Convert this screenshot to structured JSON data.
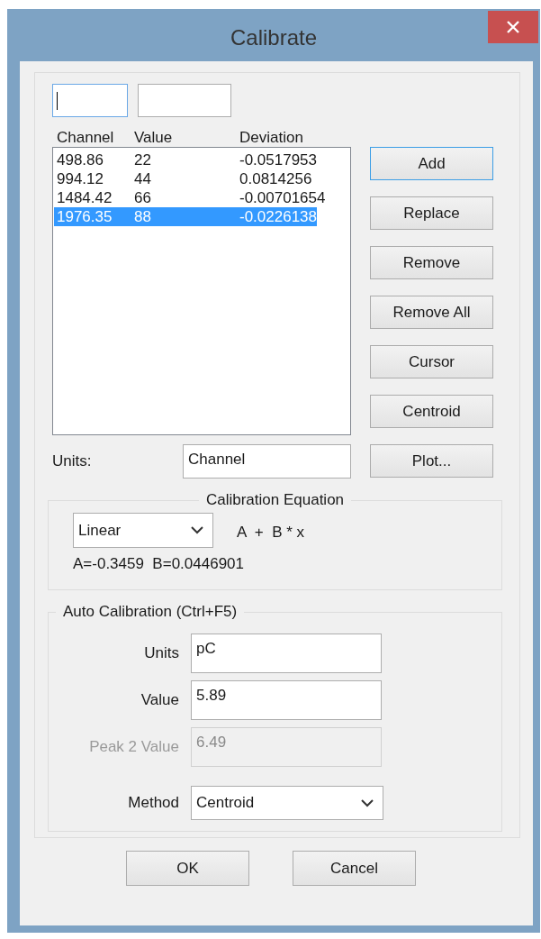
{
  "window": {
    "title": "Calibrate"
  },
  "entry_fields": [
    {
      "focused": true
    },
    {
      "focused": false
    }
  ],
  "list": {
    "columns": [
      "Channel",
      "Value",
      "Deviation"
    ],
    "rows": [
      {
        "cells": [
          "498.86",
          "22",
          "-0.0517953"
        ],
        "selected": false
      },
      {
        "cells": [
          "994.12",
          "44",
          "0.0814256"
        ],
        "selected": false
      },
      {
        "cells": [
          "1484.42",
          "66",
          "-0.00701654"
        ],
        "selected": false
      },
      {
        "cells": [
          "1976.35",
          "88",
          "-0.0226138"
        ],
        "selected": true
      }
    ]
  },
  "buttons": [
    {
      "label": "Add",
      "default": true
    },
    {
      "label": "Replace",
      "default": false
    },
    {
      "label": "Remove",
      "default": false
    },
    {
      "label": "Remove All",
      "default": false
    },
    {
      "label": "Cursor",
      "default": false
    },
    {
      "label": "Centroid",
      "default": false
    },
    {
      "label": "Plot...",
      "default": false
    }
  ],
  "units": {
    "label": "Units:",
    "value": "Channel"
  },
  "equation": {
    "title": "Calibration Equation",
    "type": "Linear",
    "formula": "A  +  B * x",
    "coefficients": "A=-0.3459  B=0.0446901"
  },
  "auto": {
    "title": "Auto Calibration (Ctrl+F5)",
    "fields": [
      {
        "kind": "text",
        "label": "Units",
        "value": "pC",
        "disabled": false
      },
      {
        "kind": "text",
        "label": "Value",
        "value": "5.89",
        "disabled": false
      },
      {
        "kind": "text",
        "label": "Peak 2 Value",
        "value": "6.49",
        "disabled": true
      },
      {
        "kind": "select",
        "label": "Method",
        "value": "Centroid",
        "disabled": false
      }
    ]
  },
  "footer_buttons": [
    "OK",
    "Cancel"
  ]
}
